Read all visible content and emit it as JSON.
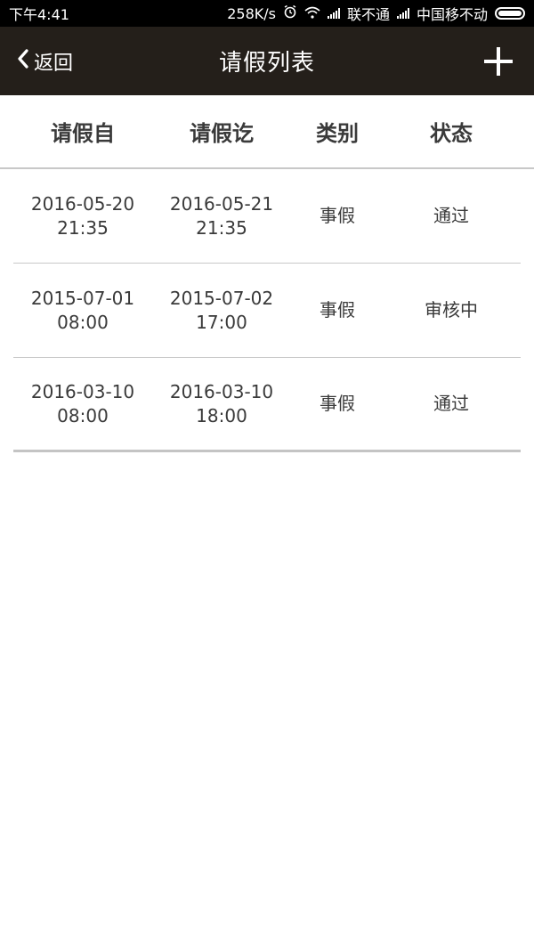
{
  "status_bar": {
    "time": "下午4:41",
    "network_speed": "258K/s",
    "carrier1": "联不通",
    "carrier2": "中国移不动",
    "icons": [
      "alarm-icon",
      "wifi-icon",
      "signal-icon",
      "signal-icon",
      "battery-icon"
    ]
  },
  "appbar": {
    "back_label": "返回",
    "title": "请假列表",
    "add_icon": "plus-icon"
  },
  "table": {
    "headers": [
      "请假自",
      "请假讫",
      "类别",
      "状态"
    ],
    "rows": [
      {
        "from_date": "2016-05-20",
        "from_time": "21:35",
        "to_date": "2016-05-21",
        "to_time": "21:35",
        "type": "事假",
        "status": "通过"
      },
      {
        "from_date": "2015-07-01",
        "from_time": "08:00",
        "to_date": "2015-07-02",
        "to_time": "17:00",
        "type": "事假",
        "status": "审核中"
      },
      {
        "from_date": "2016-03-10",
        "from_time": "08:00",
        "to_date": "2016-03-10",
        "to_time": "18:00",
        "type": "事假",
        "status": "通过"
      }
    ]
  },
  "colors": {
    "appbar_bg": "#241f1a",
    "statusbar_bg": "#000000",
    "text": "#3a3a3a",
    "divider": "#c8c8c8"
  }
}
